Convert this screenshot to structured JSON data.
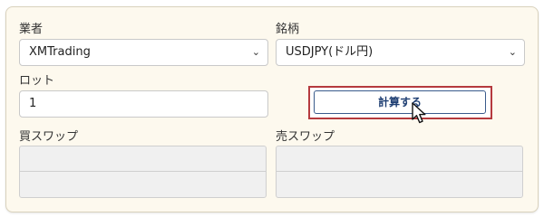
{
  "form": {
    "broker": {
      "label": "業者",
      "value": "XMTrading"
    },
    "symbol": {
      "label": "銘柄",
      "value": "USDJPY(ドル円)"
    },
    "lot": {
      "label": "ロット",
      "value": "1"
    },
    "calculate_label": "計算する",
    "buy_swap": {
      "label": "買スワップ",
      "value_1": "",
      "value_2": ""
    },
    "sell_swap": {
      "label": "売スワップ",
      "value_1": "",
      "value_2": ""
    }
  },
  "colors": {
    "panel_bg": "#fdf9ee",
    "highlight_border": "#b53a3e",
    "button_text": "#1f3f73"
  },
  "icons": {
    "select_chevron": "chevron-down-icon",
    "pointer": "mouse-pointer-icon"
  }
}
